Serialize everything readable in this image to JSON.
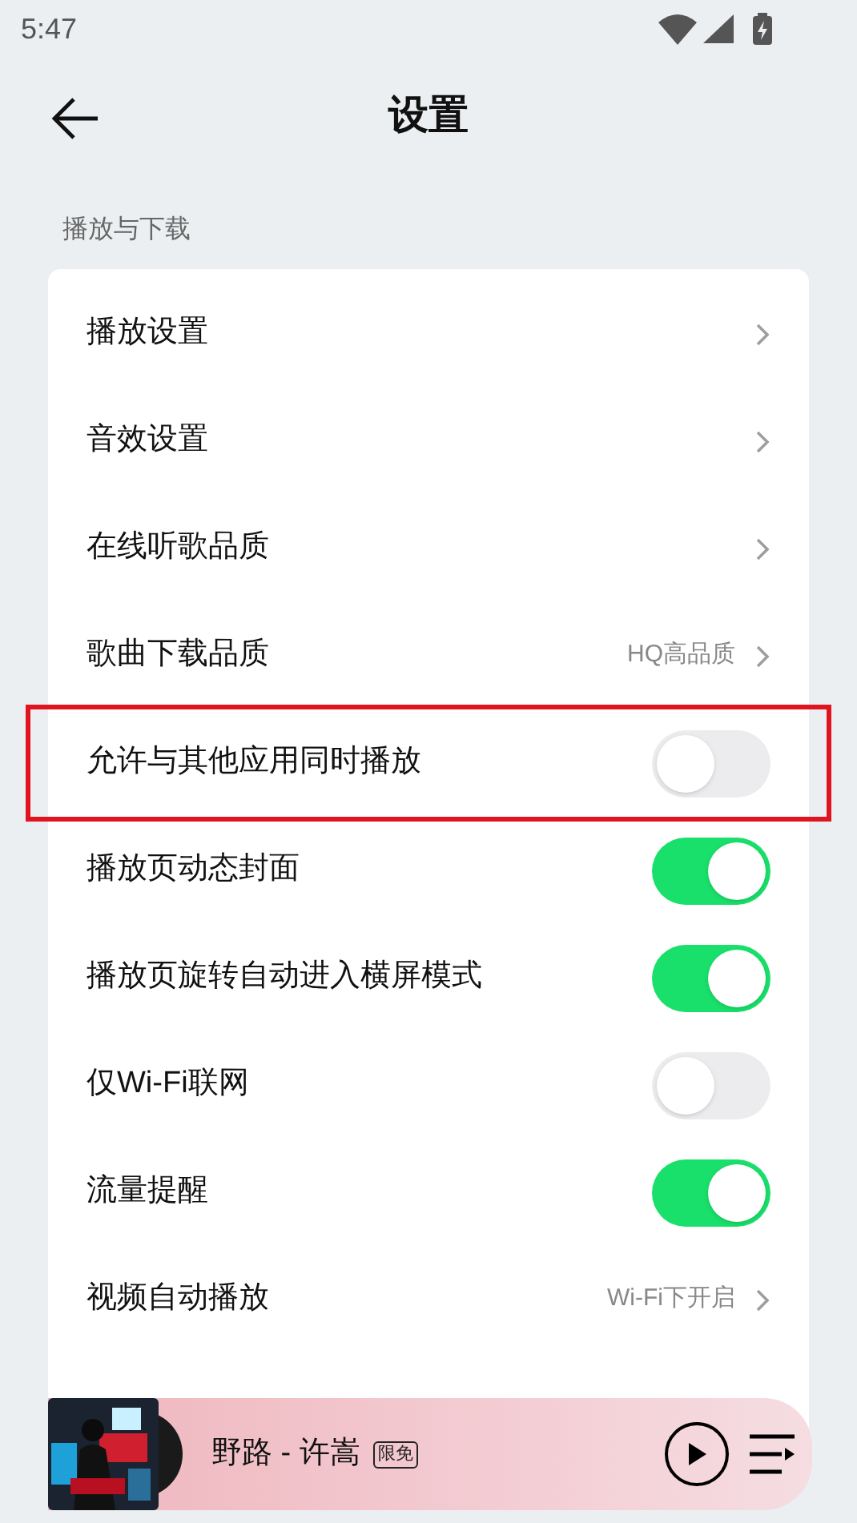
{
  "status_bar": {
    "time": "5:47"
  },
  "header": {
    "title": "设置"
  },
  "section": {
    "title": "播放与下载"
  },
  "items": [
    {
      "kind": "link",
      "label": "播放设置",
      "highlighted": false
    },
    {
      "kind": "link",
      "label": "音效设置",
      "highlighted": false
    },
    {
      "kind": "link",
      "label": "在线听歌品质",
      "highlighted": false
    },
    {
      "kind": "link",
      "label": "歌曲下载品质",
      "value": "HQ高品质",
      "highlighted": false
    },
    {
      "kind": "toggle",
      "label": "允许与其他应用同时播放",
      "on": false,
      "highlighted": true
    },
    {
      "kind": "toggle",
      "label": "播放页动态封面",
      "on": true,
      "highlighted": false
    },
    {
      "kind": "toggle",
      "label": "播放页旋转自动进入横屏模式",
      "on": true,
      "highlighted": false
    },
    {
      "kind": "toggle",
      "label": "仅Wi-Fi联网",
      "on": false,
      "highlighted": false
    },
    {
      "kind": "toggle",
      "label": "流量提醒",
      "on": true,
      "highlighted": false
    },
    {
      "kind": "link",
      "label": "视频自动播放",
      "value": "Wi-Fi下开启",
      "highlighted": false
    }
  ],
  "player": {
    "title": "野路 - 许嵩",
    "badge": "限免",
    "playing": false
  }
}
